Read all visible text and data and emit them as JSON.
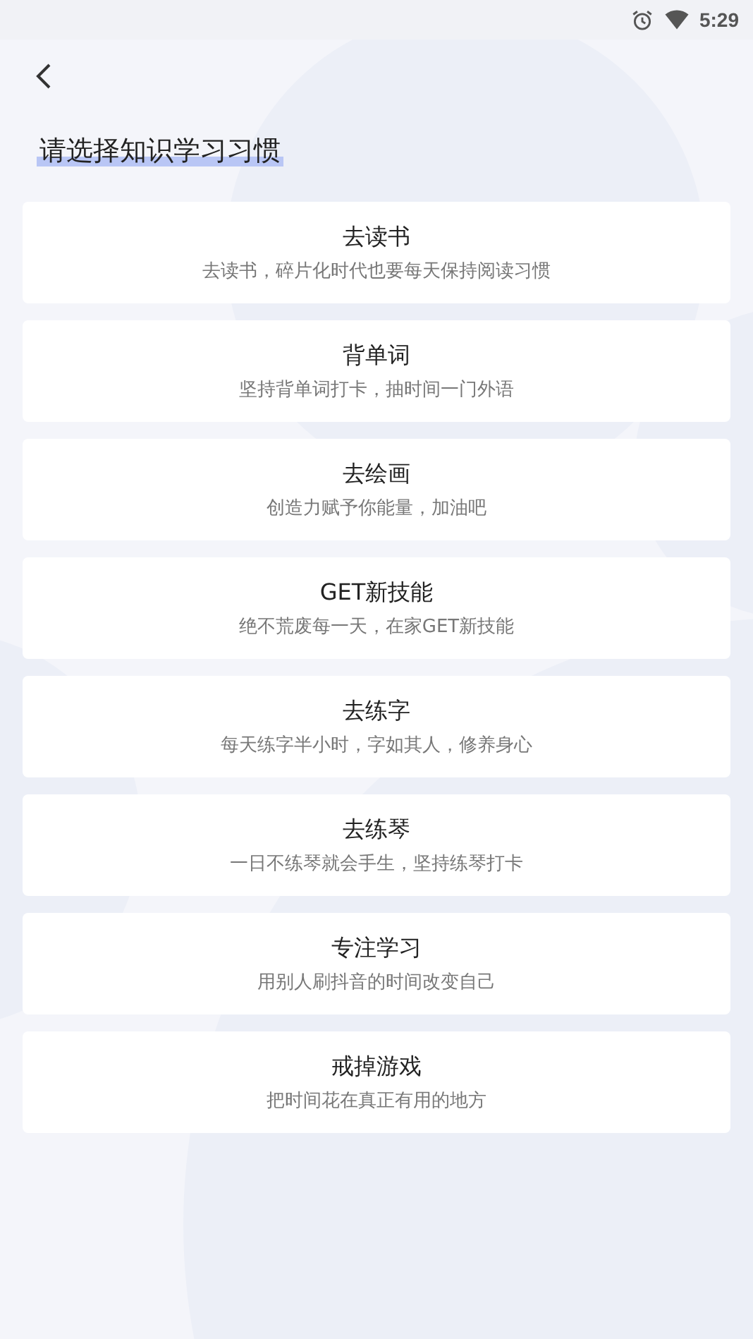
{
  "status_bar": {
    "time": "5:29"
  },
  "title": "请选择知识学习习惯",
  "options": [
    {
      "title": "去读书",
      "subtitle": "去读书，碎片化时代也要每天保持阅读习惯"
    },
    {
      "title": "背单词",
      "subtitle": "坚持背单词打卡，抽时间一门外语"
    },
    {
      "title": "去绘画",
      "subtitle": "创造力赋予你能量，加油吧"
    },
    {
      "title": "GET新技能",
      "subtitle": "绝不荒废每一天，在家GET新技能"
    },
    {
      "title": "去练字",
      "subtitle": "每天练字半小时，字如其人，修养身心"
    },
    {
      "title": "去练琴",
      "subtitle": "一日不练琴就会手生，坚持练琴打卡"
    },
    {
      "title": "专注学习",
      "subtitle": "用别人刷抖音的时间改变自己"
    },
    {
      "title": "戒掉游戏",
      "subtitle": "把时间花在真正有用的地方"
    }
  ]
}
